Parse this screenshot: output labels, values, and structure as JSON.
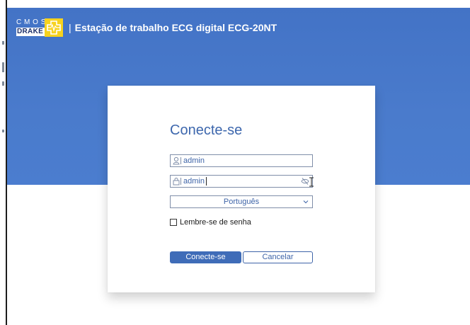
{
  "header": {
    "logo": {
      "line1": "CMOS",
      "line2": "DRAKE"
    },
    "separator": "|",
    "title": "Estação de trabalho ECG digital ECG-20NT"
  },
  "login": {
    "title": "Conecte-se",
    "username": {
      "value": "admin",
      "icon": "user-icon"
    },
    "password": {
      "value": "admin",
      "icon": "lock-icon",
      "toggle_icon": "eye-slash-icon"
    },
    "language": {
      "selected": "Português",
      "icon": "chevron-down-icon"
    },
    "remember_label": "Lembre-se de senha",
    "login_button": "Conecte-se",
    "cancel_button": "Cancelar"
  },
  "colors": {
    "banner": "#4a7bcc",
    "accent": "#3f6cb8",
    "text_accent": "#3e64a8",
    "logo_yellow": "#f7d21e"
  }
}
